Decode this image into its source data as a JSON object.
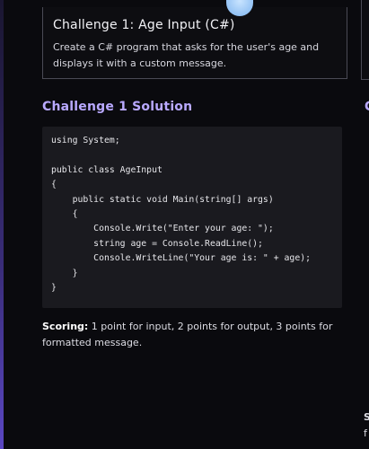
{
  "challenge_card": {
    "title": "Challenge 1: Age Input (C#)",
    "description": "Create a C# program that asks for the user's age and displays it with a custom message."
  },
  "solution": {
    "title": "Challenge 1 Solution",
    "code": "using System;\n\npublic class AgeInput\n{\n    public static void Main(string[] args)\n    {\n        Console.Write(\"Enter your age: \");\n        string age = Console.ReadLine();\n        Console.WriteLine(\"Your age is: \" + age);\n    }\n}",
    "scoring_label": "Scoring:",
    "scoring_text": " 1 point for input, 2 points for output, 3 points for formatted message."
  },
  "next_column": {
    "title_fragment": "C",
    "scoring_fragment_1": "S",
    "scoring_fragment_2": "f"
  },
  "colors": {
    "accent": "#b9a9ff",
    "background": "#0a0a0e",
    "code_background": "#1a1a1f"
  }
}
